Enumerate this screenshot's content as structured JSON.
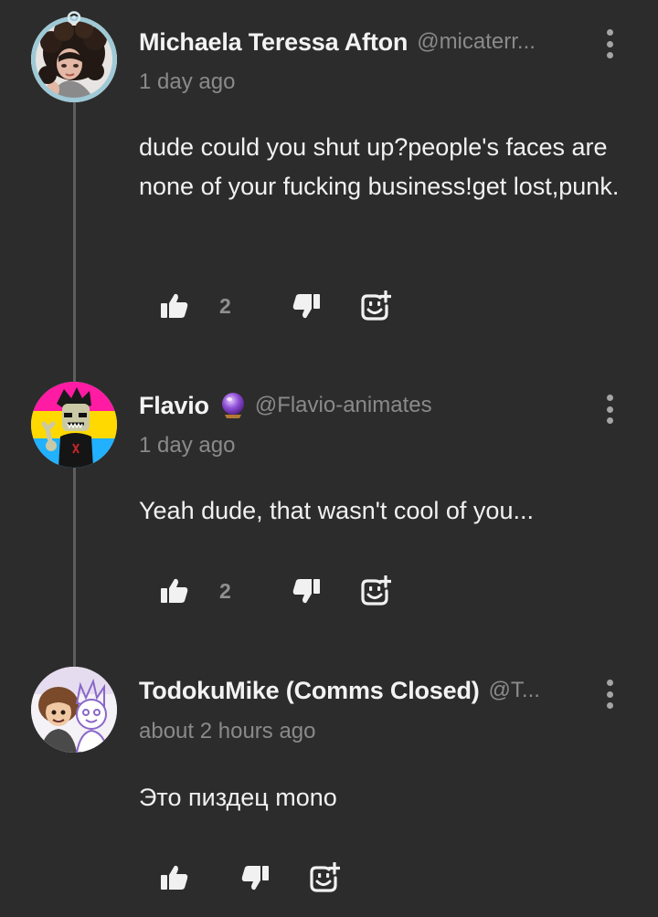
{
  "comments": [
    {
      "author": "Michaela Teressa Afton",
      "handle": "@micaterr...",
      "time": "1 day ago",
      "text": "dude could you shut up?people's faces are none of your fucking business!get lost,punk.",
      "likes": "2",
      "avatar": "dark-curly-hair-portrait",
      "has_avatar_ring": true
    },
    {
      "author": "Flavio",
      "handle": "@Flavio-animates",
      "badge": "crystal-ball-icon",
      "time": "1 day ago",
      "text": "Yeah dude, that wasn't cool of you...",
      "likes": "2",
      "avatar": "pansexual-flag-cartoon"
    },
    {
      "author": "TodokuMike (Comms Closed)",
      "handle": "@T...",
      "time": "about 2 hours ago",
      "text": "Это пиздец mono",
      "likes": "",
      "avatar": "two-sketch-characters"
    }
  ],
  "colors": {
    "background": "#2c2c2c",
    "thread_line": "#5e5e5e",
    "muted_text": "#8a8a8a",
    "primary_text": "#f1f1f1"
  },
  "icons": [
    "thumbs-up-icon",
    "thumbs-down-icon",
    "add-reaction-icon",
    "more-vertical-icon"
  ]
}
